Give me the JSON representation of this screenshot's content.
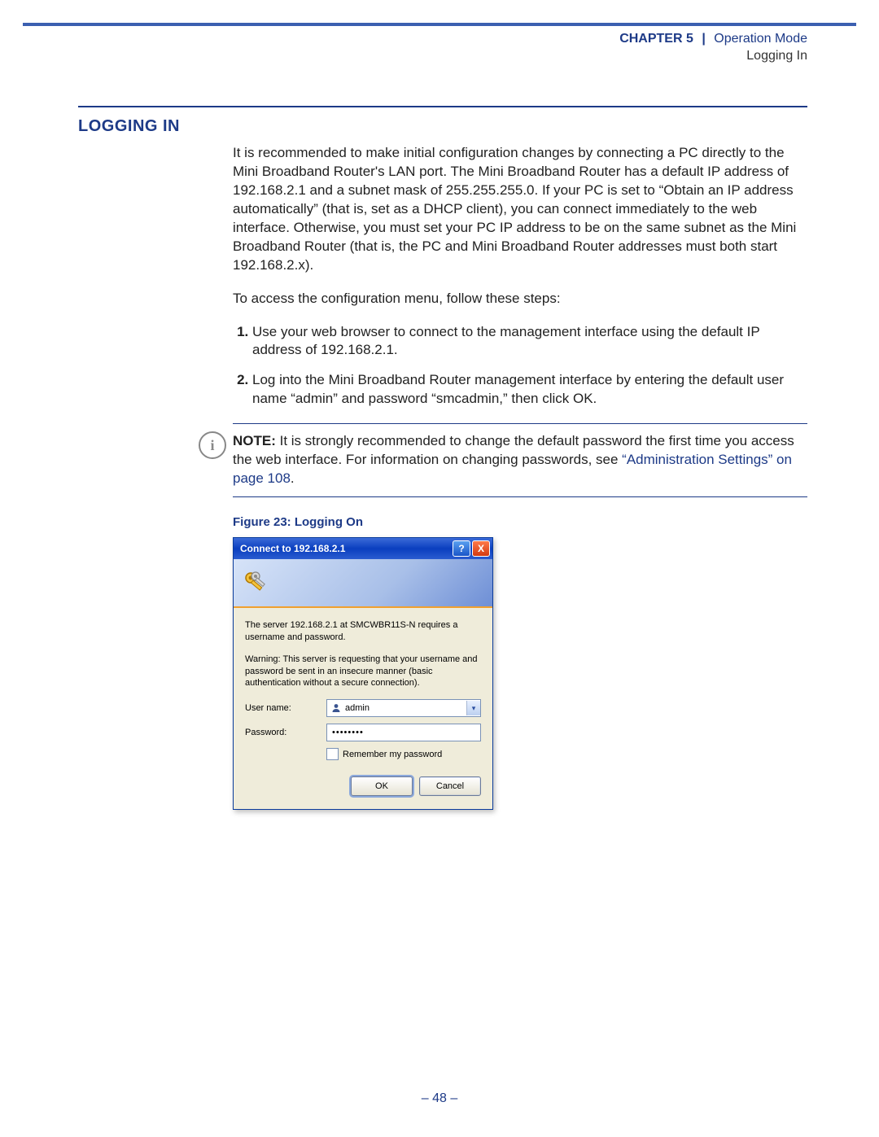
{
  "header": {
    "chapter": "CHAPTER 5",
    "sep": "|",
    "mode": "Operation Mode",
    "sub": "Logging In"
  },
  "section": {
    "title": "LOGGING IN",
    "p1": "It is recommended to make initial configuration changes by connecting a PC directly to the Mini Broadband Router's LAN port. The Mini Broadband Router has a default IP address of 192.168.2.1 and a subnet mask of 255.255.255.0. If your PC is set to “Obtain an IP address automatically” (that is, set as a DHCP client), you can connect immediately to the web interface. Otherwise, you must set your PC IP address to be on the same subnet as the Mini Broadband Router (that is, the PC and Mini Broadband Router addresses must both start 192.168.2.x).",
    "p2": "To access the configuration menu, follow these steps:",
    "step1": "Use your web browser to connect to the management interface using the default IP address of 192.168.2.1.",
    "step2": "Log into the Mini Broadband Router management interface by entering the default user name “admin” and password “smcadmin,” then click OK."
  },
  "note": {
    "icon": "i",
    "label": "NOTE:",
    "body": " It is strongly recommended to change the default password the first time you access the web interface. For information on changing passwords, see ",
    "link": "“Administration Settings” on page 108",
    "tail": "."
  },
  "figure": {
    "caption": "Figure 23:  Logging On"
  },
  "dialog": {
    "title": "Connect to 192.168.2.1",
    "help": "?",
    "close": "X",
    "serverText": "The server 192.168.2.1 at SMCWBR11S-N requires a username and password.",
    "warning": "Warning: This server is requesting that your username and password be sent in an insecure manner (basic authentication without a secure connection).",
    "userLabel": "User name:",
    "userValue": "admin",
    "passLabel": "Password:",
    "passMask": "••••••••",
    "remember": "Remember my password",
    "ok": "OK",
    "cancel": "Cancel"
  },
  "pageNumber": "–  48  –"
}
